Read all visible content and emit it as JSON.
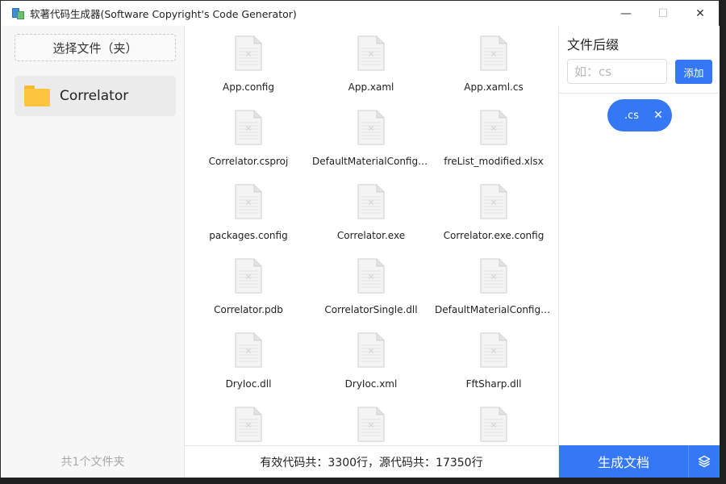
{
  "window": {
    "title": "软著代码生成器(Software Copyright's Code Generator)",
    "minimize": "—",
    "maximize": "☐",
    "close": "✕"
  },
  "left": {
    "select_button": "选择文件（夹）",
    "folders": [
      {
        "name": "Correlator",
        "icon": "folder-icon"
      }
    ],
    "folder_count": "共1个文件夹"
  },
  "files": [
    {
      "name": "App.config",
      "icon": "document-icon"
    },
    {
      "name": "App.xaml",
      "icon": "document-icon"
    },
    {
      "name": "App.xaml.cs",
      "icon": "document-icon"
    },
    {
      "name": "Correlator.csproj",
      "icon": "document-icon"
    },
    {
      "name": "DefaultMaterialConfig....",
      "icon": "document-icon"
    },
    {
      "name": "freList_modified.xlsx",
      "icon": "document-icon"
    },
    {
      "name": "packages.config",
      "icon": "document-icon"
    },
    {
      "name": "Correlator.exe",
      "icon": "document-icon"
    },
    {
      "name": "Correlator.exe.config",
      "icon": "document-icon"
    },
    {
      "name": "Correlator.pdb",
      "icon": "document-icon"
    },
    {
      "name": "CorrelatorSingle.dll",
      "icon": "document-icon"
    },
    {
      "name": "DefaultMaterialConfig....",
      "icon": "document-icon"
    },
    {
      "name": "DryIoc.dll",
      "icon": "document-icon"
    },
    {
      "name": "DryIoc.xml",
      "icon": "document-icon"
    },
    {
      "name": "FftSharp.dll",
      "icon": "document-icon"
    },
    {
      "name": "",
      "icon": "document-icon"
    },
    {
      "name": "",
      "icon": "document-icon"
    },
    {
      "name": "",
      "icon": "document-icon"
    }
  ],
  "status": {
    "text": "有效代码共：3300行，源代码共：17350行"
  },
  "right": {
    "suffix_title": "文件后缀",
    "input_placeholder": "如：cs",
    "add_button": "添加",
    "tags": [
      {
        "label": ".cs",
        "close": "✕"
      }
    ],
    "generate_button": "生成文档",
    "generate_menu_icon": "layers-icon"
  },
  "colors": {
    "accent": "#3478f6",
    "folder": "#fcc43f"
  }
}
